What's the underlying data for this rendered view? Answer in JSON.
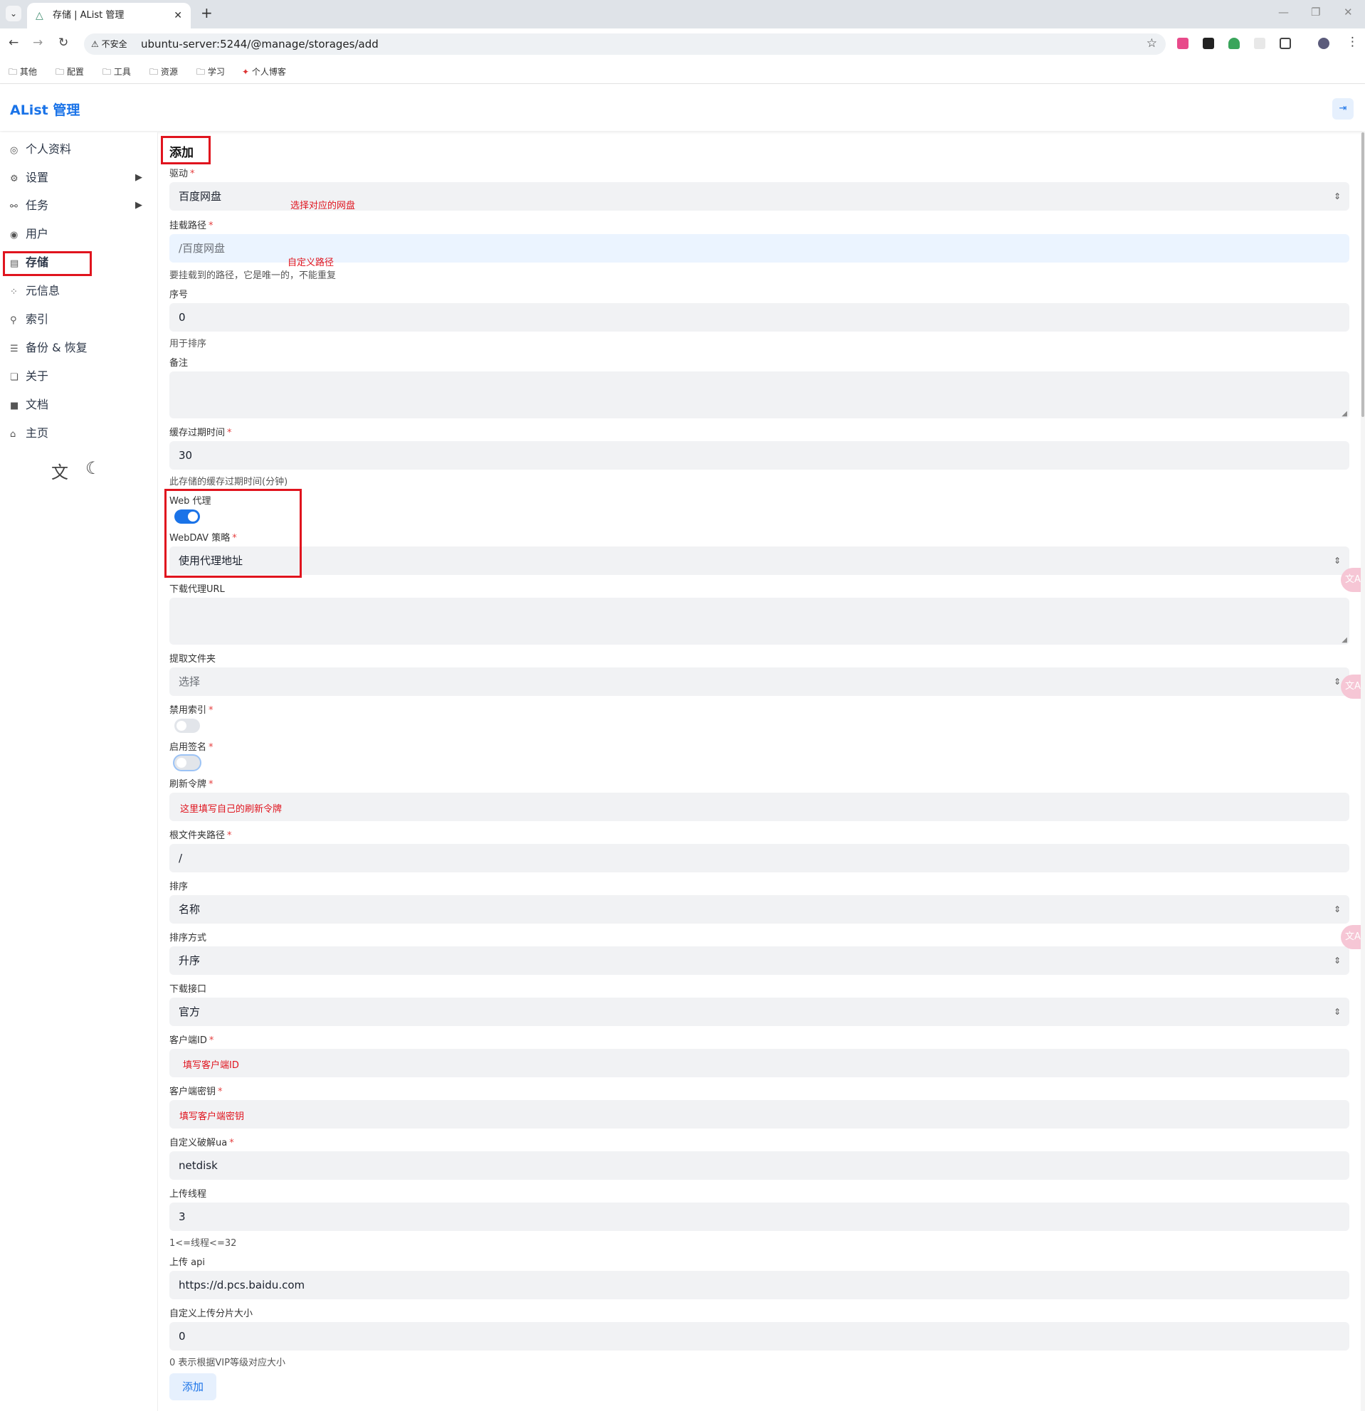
{
  "browser": {
    "tab_title": "存储 | AList 管理",
    "security_label": "不安全",
    "url": "ubuntu-server:5244/@manage/storages/add",
    "bookmarks": [
      "其他",
      "配置",
      "工具",
      "资源",
      "学习",
      "个人博客"
    ]
  },
  "app": {
    "brand": "AList 管理"
  },
  "sidebar": {
    "items": [
      {
        "label": "个人资料",
        "icon": "fingerprint-icon"
      },
      {
        "label": "设置",
        "icon": "gear-icon"
      },
      {
        "label": "任务",
        "icon": "tasks-icon"
      },
      {
        "label": "用户",
        "icon": "user-icon"
      },
      {
        "label": "存储",
        "icon": "storage-icon"
      },
      {
        "label": "元信息",
        "icon": "meta-icon"
      },
      {
        "label": "索引",
        "icon": "search-icon"
      },
      {
        "label": "备份 & 恢复",
        "icon": "database-icon"
      },
      {
        "label": "关于",
        "icon": "copy-icon"
      },
      {
        "label": "文档",
        "icon": "book-icon"
      },
      {
        "label": "主页",
        "icon": "home-icon"
      }
    ]
  },
  "form": {
    "title": "添加",
    "driver": {
      "label": "驱动",
      "value": "百度网盘",
      "annotation": "选择对应的网盘"
    },
    "mount_path": {
      "label": "挂载路径",
      "placeholder": "/百度网盘",
      "annotation": "自定义路径",
      "help": "要挂载到的路径，它是唯一的，不能重复"
    },
    "order": {
      "label": "序号",
      "value": "0",
      "help": "用于排序"
    },
    "remark": {
      "label": "备注"
    },
    "cache_expiration": {
      "label": "缓存过期时间",
      "value": "30",
      "help": "此存储的缓存过期时间(分钟)"
    },
    "web_proxy": {
      "label": "Web 代理",
      "on": true
    },
    "webdav_policy": {
      "label": "WebDAV 策略",
      "value": "使用代理地址"
    },
    "download_proxy_url": {
      "label": "下载代理URL"
    },
    "extract_folder": {
      "label": "提取文件夹",
      "placeholder": "选择"
    },
    "disable_index": {
      "label": "禁用索引",
      "on": false
    },
    "enable_sign": {
      "label": "启用签名",
      "on": false
    },
    "refresh_token": {
      "label": "刷新令牌",
      "annotation": "这里填写自己的刷新令牌"
    },
    "root_folder_path": {
      "label": "根文件夹路径",
      "value": "/"
    },
    "order_by": {
      "label": "排序",
      "value": "名称"
    },
    "order_direction": {
      "label": "排序方式",
      "value": "升序"
    },
    "download_api": {
      "label": "下载接口",
      "value": "官方"
    },
    "client_id": {
      "label": "客户端ID",
      "annotation": "填写客户端ID"
    },
    "client_secret": {
      "label": "客户端密钥",
      "annotation": "填写客户端密钥"
    },
    "custom_ua": {
      "label": "自定义破解ua",
      "value": "netdisk"
    },
    "upload_thread": {
      "label": "上传线程",
      "value": "3",
      "help": "1<=线程<=32"
    },
    "upload_api": {
      "label": "上传 api",
      "value": "https://d.pcs.baidu.com"
    },
    "custom_chunk_size": {
      "label": "自定义上传分片大小",
      "value": "0",
      "help": "0 表示根据VIP等级对应大小"
    },
    "submit_label": "添加"
  },
  "colors": {
    "accent": "#1a73e8",
    "annotation": "#e0141e",
    "required": "#e53e3e"
  }
}
